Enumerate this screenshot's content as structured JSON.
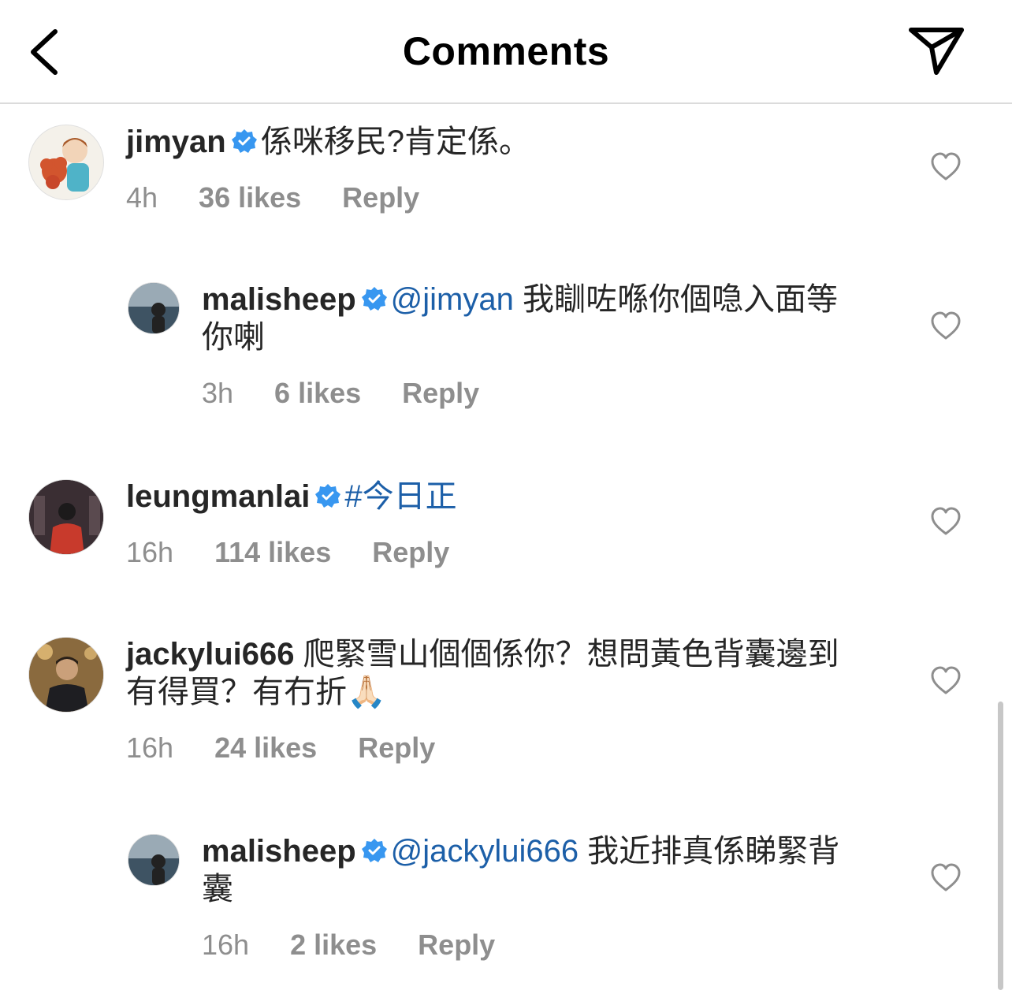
{
  "header": {
    "title": "Comments",
    "back_icon": "chevron-left-icon",
    "share_icon": "paper-plane-icon"
  },
  "comments": [
    {
      "username": "jimyan",
      "verified": true,
      "text": "係咪移民?肯定係。",
      "time": "4h",
      "likes": "36 likes",
      "reply": "Reply"
    },
    {
      "username": "malisheep",
      "verified": true,
      "mention": "@jimyan",
      "text": "我瞓咗喺你個喼入面等你喇",
      "time": "3h",
      "likes": "6 likes",
      "reply": "Reply"
    },
    {
      "username": "leungmanlai",
      "verified": true,
      "hashtag": "#今日正",
      "time": "16h",
      "likes": "114 likes",
      "reply": "Reply"
    },
    {
      "username": "jackylui666",
      "verified": false,
      "text": "爬緊雪山個個係你？想問黃色背囊邊到有得買？有冇折",
      "emoji": "🙏🏻",
      "time": "16h",
      "likes": "24 likes",
      "reply": "Reply"
    },
    {
      "username": "malisheep",
      "verified": true,
      "mention": "@jackylui666",
      "text": "我近排真係睇緊背囊",
      "time": "16h",
      "likes": "2 likes",
      "reply": "Reply"
    }
  ],
  "colors": {
    "verified": "#3897f0",
    "link": "#1c5fa8",
    "meta": "#8e8e8e",
    "text": "#262626"
  }
}
